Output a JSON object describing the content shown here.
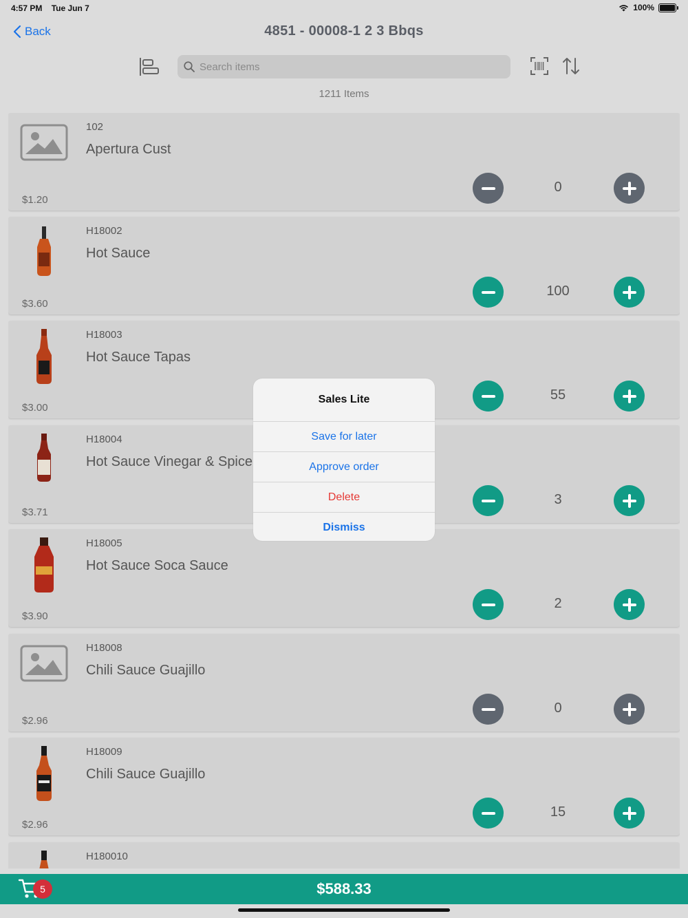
{
  "status_bar": {
    "time": "4:57 PM",
    "date": "Tue Jun 7",
    "battery": "100%"
  },
  "nav": {
    "back_label": "Back",
    "title": "4851 - 00008-1 2 3 Bbqs"
  },
  "search": {
    "placeholder": "Search items"
  },
  "item_count": "1211 Items",
  "items": [
    {
      "code": "102",
      "name": "Apertura Cust",
      "price": "$1.20",
      "qty": "0",
      "image": "placeholder-image-icon",
      "active": false
    },
    {
      "code": "H18002",
      "name": "Hot Sauce",
      "price": "$3.60",
      "qty": "100",
      "image": "bottle-short",
      "active": true
    },
    {
      "code": "H18003",
      "name": "Hot Sauce Tapas",
      "price": "$3.00",
      "qty": "55",
      "image": "bottle-tall",
      "active": true
    },
    {
      "code": "H18004",
      "name": "Hot Sauce Vinegar & Spice",
      "price": "$3.71",
      "qty": "3",
      "image": "bottle-small",
      "active": true
    },
    {
      "code": "H18005",
      "name": "Hot Sauce Soca Sauce",
      "price": "$3.90",
      "qty": "2",
      "image": "bottle-wide",
      "active": true
    },
    {
      "code": "H18008",
      "name": "Chili Sauce Guajillo",
      "price": "$2.96",
      "qty": "0",
      "image": "placeholder-image-icon",
      "active": false
    },
    {
      "code": "H18009",
      "name": "Chili Sauce Guajillo",
      "price": "$2.96",
      "qty": "15",
      "image": "bottle-label",
      "active": true
    },
    {
      "code": "H180010",
      "name": "",
      "price": "",
      "qty": "",
      "image": "bottle-dark",
      "active": true
    }
  ],
  "footer": {
    "cart_badge": "5",
    "total": "$588.33"
  },
  "dialog": {
    "title": "Sales Lite",
    "save_label": "Save for later",
    "approve_label": "Approve order",
    "delete_label": "Delete",
    "dismiss_label": "Dismiss"
  },
  "colors": {
    "accent": "#119b86",
    "inactive": "#5f6670",
    "link": "#1a73e8",
    "destructive": "#e53935",
    "badge": "#d32f3a"
  }
}
